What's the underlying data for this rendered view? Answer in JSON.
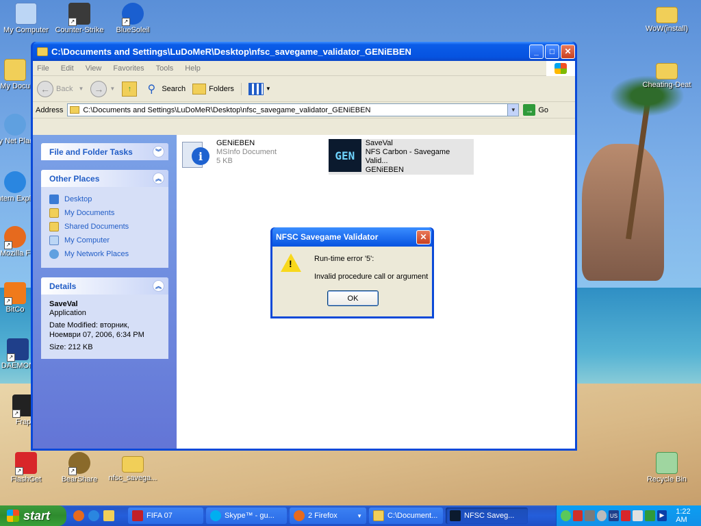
{
  "desktop": {
    "icons": [
      {
        "label": "My Computer"
      },
      {
        "label": "Counter-Strike"
      },
      {
        "label": "BlueSoleil"
      },
      {
        "label": "WoW(install)"
      },
      {
        "label": "My Docu"
      },
      {
        "label": "Cheating-Deat"
      },
      {
        "label": "My Net Place"
      },
      {
        "label": "Intern Explo"
      },
      {
        "label": "Mozilla F"
      },
      {
        "label": "BitCo"
      },
      {
        "label": "DAEMON"
      },
      {
        "label": "Frap"
      },
      {
        "label": "FlashGet"
      },
      {
        "label": "BearShare"
      },
      {
        "label": "nfsc_savega..."
      },
      {
        "label": "Recycle Bin"
      }
    ]
  },
  "explorer": {
    "title": "C:\\Documents and Settings\\LuDoMeR\\Desktop\\nfsc_savegame_validator_GENiEBEN",
    "menu": [
      "File",
      "Edit",
      "View",
      "Favorites",
      "Tools",
      "Help"
    ],
    "toolbar": {
      "back": "Back",
      "search": "Search",
      "folders": "Folders"
    },
    "address": {
      "label": "Address",
      "value": "C:\\Documents and Settings\\LuDoMeR\\Desktop\\nfsc_savegame_validator_GENiEBEN",
      "go": "Go"
    },
    "tasks": {
      "file_folder_title": "File and Folder Tasks",
      "other_places_title": "Other Places",
      "other_places": [
        "Desktop",
        "My Documents",
        "Shared Documents",
        "My Computer",
        "My Network Places"
      ],
      "details_title": "Details",
      "details": {
        "name": "SaveVal",
        "type": "Application",
        "modified_1": "Date Modified: вторник,",
        "modified_2": "Ноември 07, 2006, 6:34 PM",
        "size": "Size: 212 KB"
      }
    },
    "files": [
      {
        "name": "GENiEBEN",
        "line2": "MSInfo Document",
        "line3": "5 KB"
      },
      {
        "name": "SaveVal",
        "line2": "NFS Carbon - Savegame Valid...",
        "line3": "GENiEBEN"
      }
    ]
  },
  "dialog": {
    "title": "NFSC Savegame Validator",
    "line1": "Run-time error '5':",
    "line2": "Invalid procedure call or argument",
    "ok": "OK"
  },
  "taskbar": {
    "start": "start",
    "tasks": [
      {
        "label": "FIFA 07"
      },
      {
        "label": "Skype™ - gu..."
      },
      {
        "label": "2 Firefox"
      },
      {
        "label": "C:\\Document..."
      },
      {
        "label": "NFSC Saveg..."
      }
    ],
    "tray_lang": "US",
    "clock": "1:22 AM"
  },
  "colors": {
    "xp_blue": "#0a49d8",
    "task_link": "#215dc6",
    "start_green": "#3c9b3c"
  }
}
